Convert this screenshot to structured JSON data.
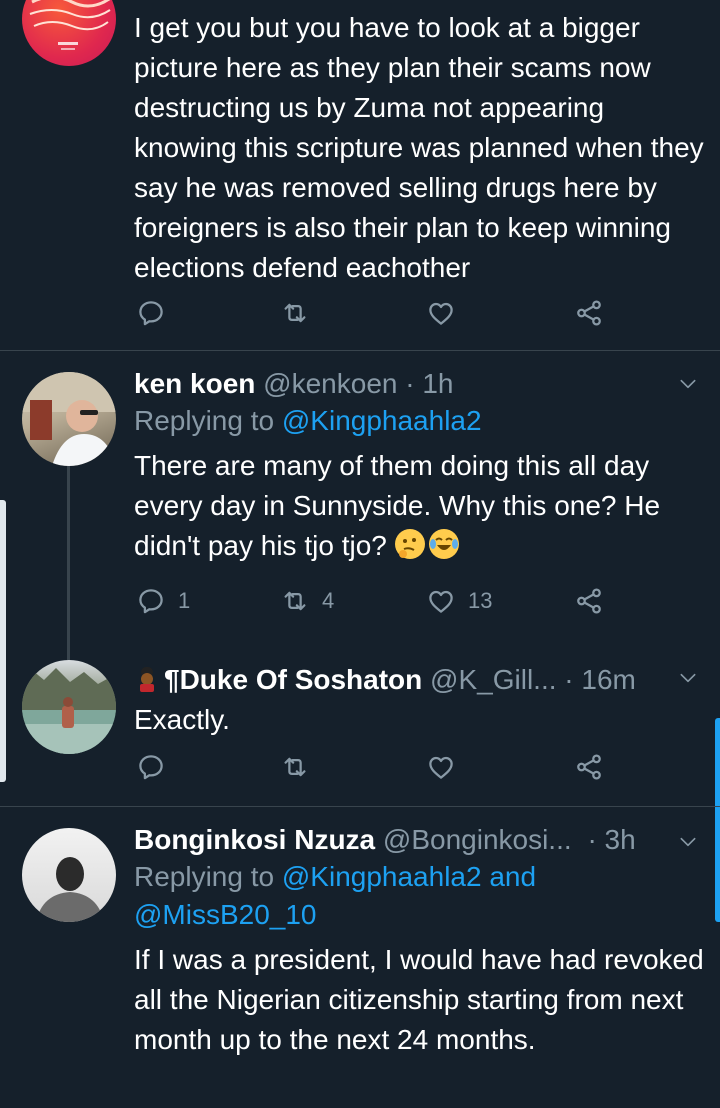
{
  "tweets": [
    {
      "body": "I get you but you have to look at a bigger picture here as they plan their scams now destructing us by Zuma not appearing knowing this scripture was planned when they say he was removed selling drugs here by foreigners is also their plan to keep winning elections defend eachother",
      "replies": "",
      "retweets": "",
      "likes": ""
    },
    {
      "name": "ken koen",
      "handle": "@kenkoen",
      "time": "· 1h",
      "replying_prefix": "Replying to ",
      "replying_to": "@Kingphaahla2",
      "body": "There are many of them doing this all day every day in Sunnyside. Why this one? He didn't pay his tjo tjo?",
      "replies": "1",
      "retweets": "4",
      "likes": "13"
    },
    {
      "name": "¶Duke Of Soshaton",
      "handle": "@K_Gill...",
      "time": "· 16m",
      "body": "Exactly.",
      "replies": "",
      "retweets": "",
      "likes": ""
    },
    {
      "name": "Bonginkosi Nzuza",
      "handle": "@Bonginkosi...",
      "time": "· 3h",
      "replying_prefix": "Replying to ",
      "replying_to": "@Kingphaahla2",
      "replying_and": " and",
      "replying_to_2": "@MissB20_10",
      "body": "If I was a president, I would have had revoked all the Nigerian citizenship starting from next month up to the next 24 months."
    }
  ],
  "colors": {
    "background": "#15202b",
    "divider": "#38444d",
    "secondary_text": "#8899a6",
    "link": "#1da1f2"
  },
  "icons": [
    "reply-icon",
    "retweet-icon",
    "like-icon",
    "share-icon",
    "chevron-down-icon"
  ]
}
